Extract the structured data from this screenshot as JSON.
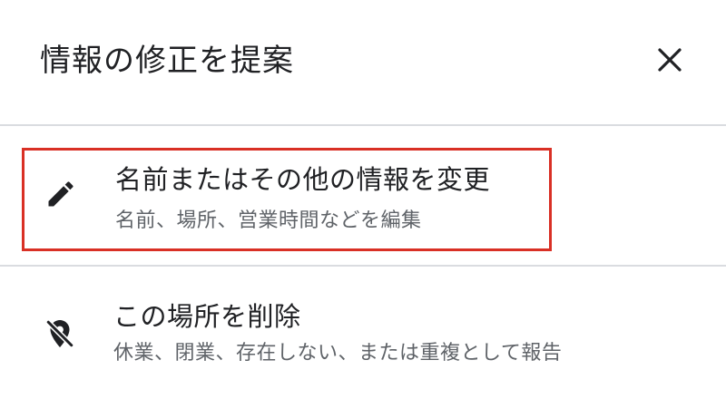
{
  "dialog": {
    "title": "情報の修正を提案",
    "close_icon": "close-icon"
  },
  "options": [
    {
      "icon": "pencil-icon",
      "title": "名前またはその他の情報を変更",
      "subtitle": "名前、場所、営業時間などを編集",
      "highlighted": true,
      "highlight_color": "#d93025"
    },
    {
      "icon": "location-off-icon",
      "title": "この場所を削除",
      "subtitle": "休業、閉業、存在しない、または重複として報告"
    }
  ],
  "colors": {
    "primary_text": "#202124",
    "secondary_text": "#5f6368",
    "divider": "#dadce0"
  }
}
